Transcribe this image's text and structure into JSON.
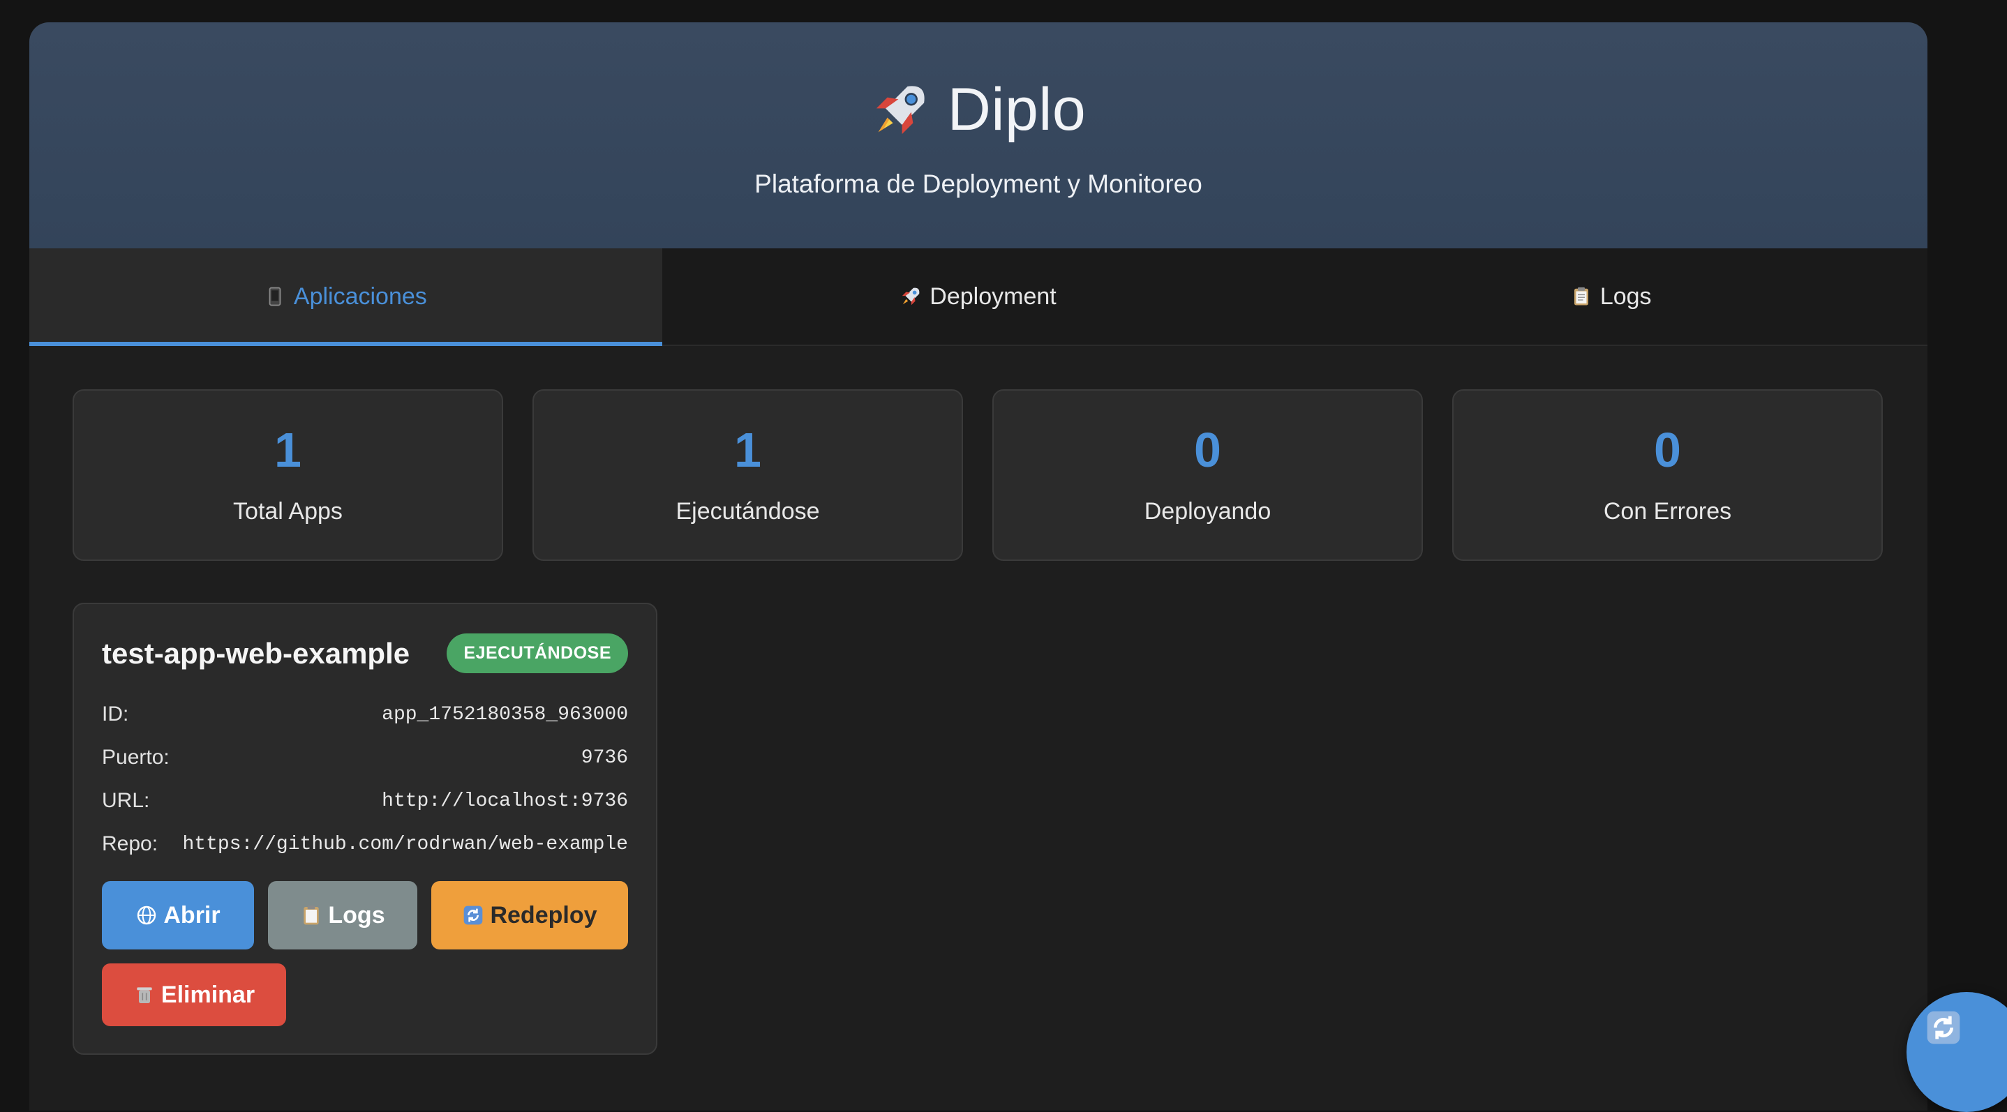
{
  "header": {
    "title": "Diplo",
    "subtitle": "Plataforma de Deployment y Monitoreo",
    "logo_icon": "rocket-icon"
  },
  "tabs": [
    {
      "label": "Aplicaciones",
      "icon": "phone-icon",
      "active": true
    },
    {
      "label": "Deployment",
      "icon": "rocket-icon",
      "active": false
    },
    {
      "label": "Logs",
      "icon": "clipboard-icon",
      "active": false
    }
  ],
  "stats": [
    {
      "value": "1",
      "label": "Total Apps"
    },
    {
      "value": "1",
      "label": "Ejecutándose"
    },
    {
      "value": "0",
      "label": "Deployando"
    },
    {
      "value": "0",
      "label": "Con Errores"
    }
  ],
  "app": {
    "name": "test-app-web-example",
    "status": "EJECUTÁNDOSE",
    "fields": [
      {
        "key": "ID:",
        "value": "app_1752180358_963000"
      },
      {
        "key": "Puerto:",
        "value": "9736"
      },
      {
        "key": "URL:",
        "value": "http://localhost:9736"
      },
      {
        "key": "Repo:",
        "value": "https://github.com/rodrwan/web-example"
      }
    ],
    "buttons": {
      "open": "Abrir",
      "logs": "Logs",
      "redeploy": "Redeploy",
      "delete": "Eliminar"
    }
  },
  "colors": {
    "accent": "#4a90d9",
    "running": "#4aa564",
    "warning": "#ef9f3c",
    "danger": "#dc4d3f",
    "neutral": "#7f8c8d"
  },
  "fab": {
    "icon": "refresh-icon"
  }
}
